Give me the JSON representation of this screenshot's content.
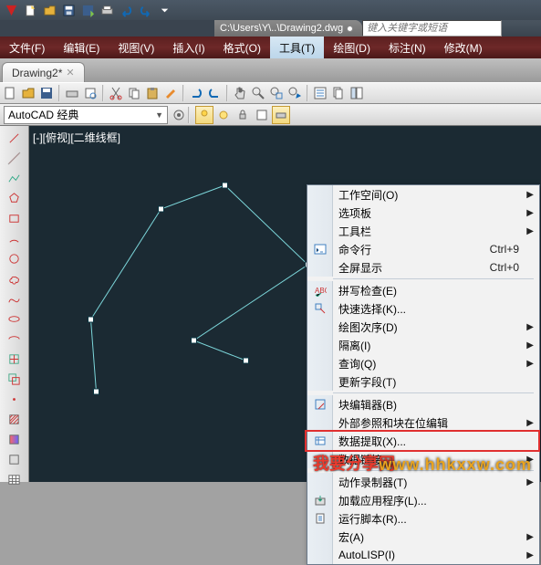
{
  "title": {
    "path": "C:\\Users\\Y\\..\\Drawing2.dwg"
  },
  "search": {
    "placeholder": "键入关键字或短语"
  },
  "menubar": {
    "items": [
      {
        "label": "文件(F)"
      },
      {
        "label": "编辑(E)"
      },
      {
        "label": "视图(V)"
      },
      {
        "label": "插入(I)"
      },
      {
        "label": "格式(O)"
      },
      {
        "label": "工具(T)"
      },
      {
        "label": "绘图(D)"
      },
      {
        "label": "标注(N)"
      },
      {
        "label": "修改(M)"
      }
    ]
  },
  "doc_tab": {
    "name": "Drawing2*"
  },
  "workspace_select": {
    "value": "AutoCAD 经典"
  },
  "canvas_label": "[-][俯视][二维线框]",
  "tools_menu": {
    "items": [
      {
        "label": "工作空间(O)",
        "sub": true
      },
      {
        "label": "选项板",
        "sub": true
      },
      {
        "label": "工具栏",
        "sub": true
      },
      {
        "label": "命令行",
        "accel": "Ctrl+9"
      },
      {
        "label": "全屏显示",
        "accel": "Ctrl+0"
      },
      {
        "sep": true
      },
      {
        "label": "拼写检查(E)"
      },
      {
        "label": "快速选择(K)..."
      },
      {
        "label": "绘图次序(D)",
        "sub": true
      },
      {
        "label": "隔离(I)",
        "sub": true
      },
      {
        "label": "查询(Q)",
        "sub": true
      },
      {
        "label": "更新字段(T)"
      },
      {
        "sep": true
      },
      {
        "label": "块编辑器(B)"
      },
      {
        "label": "外部参照和块在位编辑",
        "sub": true
      },
      {
        "label": "数据提取(X)...",
        "highlight": true
      },
      {
        "label": "数据链接",
        "sub": true
      },
      {
        "sep": true
      },
      {
        "label": "动作录制器(T)",
        "sub": true
      },
      {
        "label": "加载应用程序(L)..."
      },
      {
        "label": "运行脚本(R)..."
      },
      {
        "label": "宏(A)",
        "sub": true
      },
      {
        "label": "AutoLISP(I)",
        "sub": true
      }
    ]
  },
  "watermark_red": "我要分享网",
  "watermark_orange": "www.hhkxxw.com"
}
